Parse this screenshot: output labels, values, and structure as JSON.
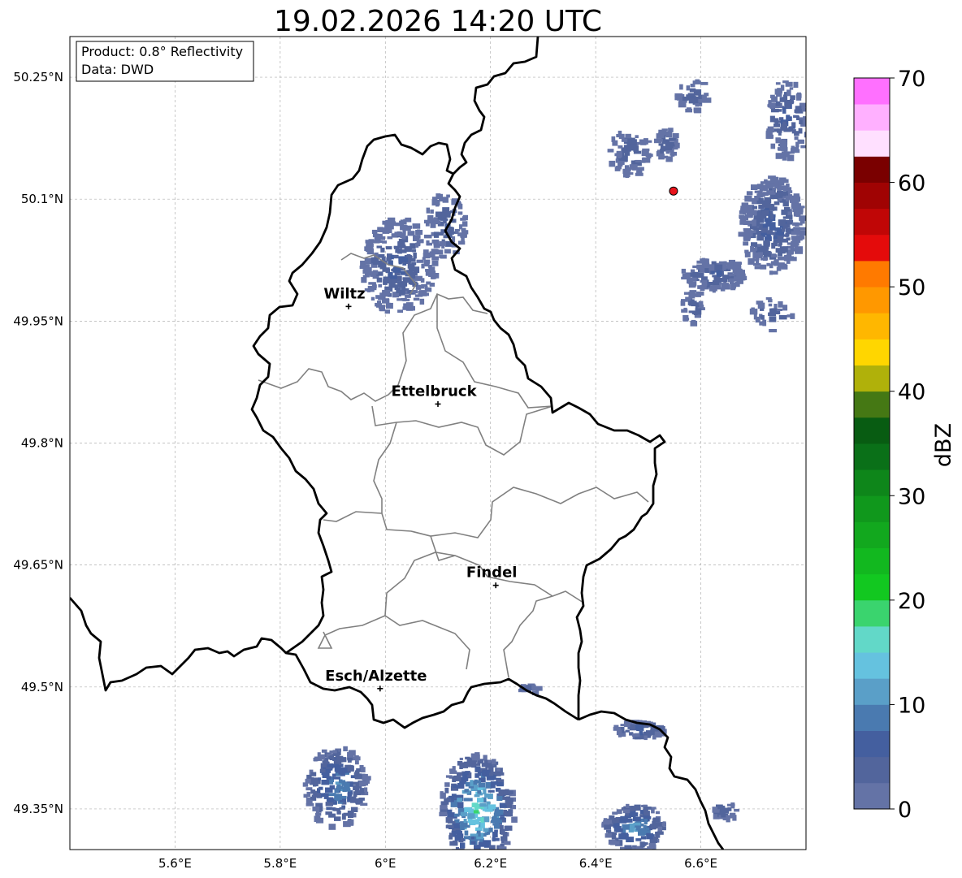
{
  "title": "19.02.2026 14:20 UTC",
  "info_box": {
    "product": "Product: 0.8° Reflectivity",
    "data": "Data: DWD"
  },
  "axes": {
    "lon_range": [
      5.4,
      6.8
    ],
    "lat_range": [
      49.3,
      50.3
    ],
    "lon_ticks": [
      {
        "value": 5.6,
        "label": "5.6°E"
      },
      {
        "value": 5.8,
        "label": "5.8°E"
      },
      {
        "value": 6.0,
        "label": "6°E"
      },
      {
        "value": 6.2,
        "label": "6.2°E"
      },
      {
        "value": 6.4,
        "label": "6.4°E"
      },
      {
        "value": 6.6,
        "label": "6.6°E"
      }
    ],
    "lat_ticks": [
      {
        "value": 50.25,
        "label": "50.25°N"
      },
      {
        "value": 50.1,
        "label": "50.1°N"
      },
      {
        "value": 49.95,
        "label": "49.95°N"
      },
      {
        "value": 49.8,
        "label": "49.8°N"
      },
      {
        "value": 49.65,
        "label": "49.65°N"
      },
      {
        "value": 49.5,
        "label": "49.5°N"
      },
      {
        "value": 49.35,
        "label": "49.35°N"
      }
    ],
    "gridlines": true
  },
  "cities": [
    {
      "name": "Wiltz",
      "lon": 5.93,
      "lat": 49.968
    },
    {
      "name": "Ettelbruck",
      "lon": 6.1,
      "lat": 49.848
    },
    {
      "name": "Findel",
      "lon": 6.21,
      "lat": 49.625
    },
    {
      "name": "Esch/Alzette",
      "lon": 5.99,
      "lat": 49.498
    }
  ],
  "radar_site": {
    "lon": 6.548,
    "lat": 50.11,
    "color": "#e8131b"
  },
  "colorbar": {
    "label": "dBZ",
    "min": 0,
    "max": 70,
    "step": 2.5,
    "ticks": [
      {
        "value": 0,
        "label": "0"
      },
      {
        "value": 10,
        "label": "10"
      },
      {
        "value": 20,
        "label": "20"
      },
      {
        "value": 30,
        "label": "30"
      },
      {
        "value": 40,
        "label": "40"
      },
      {
        "value": 50,
        "label": "50"
      },
      {
        "value": 60,
        "label": "60"
      },
      {
        "value": 70,
        "label": "70"
      }
    ],
    "colors": [
      "#6473a6",
      "#52659c",
      "#445f9f",
      "#4a7ab0",
      "#5a9fc8",
      "#65c2df",
      "#62d8c8",
      "#3ad46e",
      "#12c820",
      "#12b81f",
      "#12a81e",
      "#10981c",
      "#0e861a",
      "#0a7018",
      "#085c12",
      "#457814",
      "#b0b10a",
      "#ffd600",
      "#ffb700",
      "#ff9800",
      "#ff7a00",
      "#e40b0b",
      "#c00606",
      "#a00303",
      "#7a0000",
      "#ffe0ff",
      "#ffb0ff",
      "#ff70ff",
      "#ee38ee"
    ]
  },
  "echo_clusters": [
    {
      "lon": 6.02,
      "lat": 50.02,
      "dlon": 0.07,
      "dlat": 0.06,
      "n": 260,
      "maxdbz": 7
    },
    {
      "lon": 6.11,
      "lat": 50.07,
      "dlon": 0.04,
      "dlat": 0.04,
      "n": 90,
      "maxdbz": 6
    },
    {
      "lon": 6.46,
      "lat": 50.16,
      "dlon": 0.04,
      "dlat": 0.03,
      "n": 70,
      "maxdbz": 6
    },
    {
      "lon": 6.53,
      "lat": 50.17,
      "dlon": 0.02,
      "dlat": 0.02,
      "n": 40,
      "maxdbz": 6
    },
    {
      "lon": 6.58,
      "lat": 50.23,
      "dlon": 0.03,
      "dlat": 0.02,
      "n": 40,
      "maxdbz": 6
    },
    {
      "lon": 6.73,
      "lat": 50.07,
      "dlon": 0.06,
      "dlat": 0.06,
      "n": 320,
      "maxdbz": 8
    },
    {
      "lon": 6.76,
      "lat": 50.2,
      "dlon": 0.04,
      "dlat": 0.05,
      "n": 110,
      "maxdbz": 8
    },
    {
      "lon": 6.62,
      "lat": 50.01,
      "dlon": 0.06,
      "dlat": 0.02,
      "n": 130,
      "maxdbz": 7
    },
    {
      "lon": 6.58,
      "lat": 49.97,
      "dlon": 0.02,
      "dlat": 0.02,
      "n": 30,
      "maxdbz": 6
    },
    {
      "lon": 6.73,
      "lat": 49.96,
      "dlon": 0.04,
      "dlat": 0.02,
      "n": 30,
      "maxdbz": 6
    },
    {
      "lon": 6.27,
      "lat": 49.5,
      "dlon": 0.02,
      "dlat": 0.005,
      "n": 12,
      "maxdbz": 9
    },
    {
      "lon": 6.48,
      "lat": 49.45,
      "dlon": 0.05,
      "dlat": 0.01,
      "n": 60,
      "maxdbz": 10
    },
    {
      "lon": 5.9,
      "lat": 49.38,
      "dlon": 0.06,
      "dlat": 0.05,
      "n": 200,
      "maxdbz": 13
    },
    {
      "lon": 6.17,
      "lat": 49.35,
      "dlon": 0.07,
      "dlat": 0.07,
      "n": 300,
      "maxdbz": 20
    },
    {
      "lon": 6.47,
      "lat": 49.33,
      "dlon": 0.06,
      "dlat": 0.03,
      "n": 140,
      "maxdbz": 14
    },
    {
      "lon": 6.64,
      "lat": 49.35,
      "dlon": 0.03,
      "dlat": 0.01,
      "n": 30,
      "maxdbz": 7
    }
  ]
}
